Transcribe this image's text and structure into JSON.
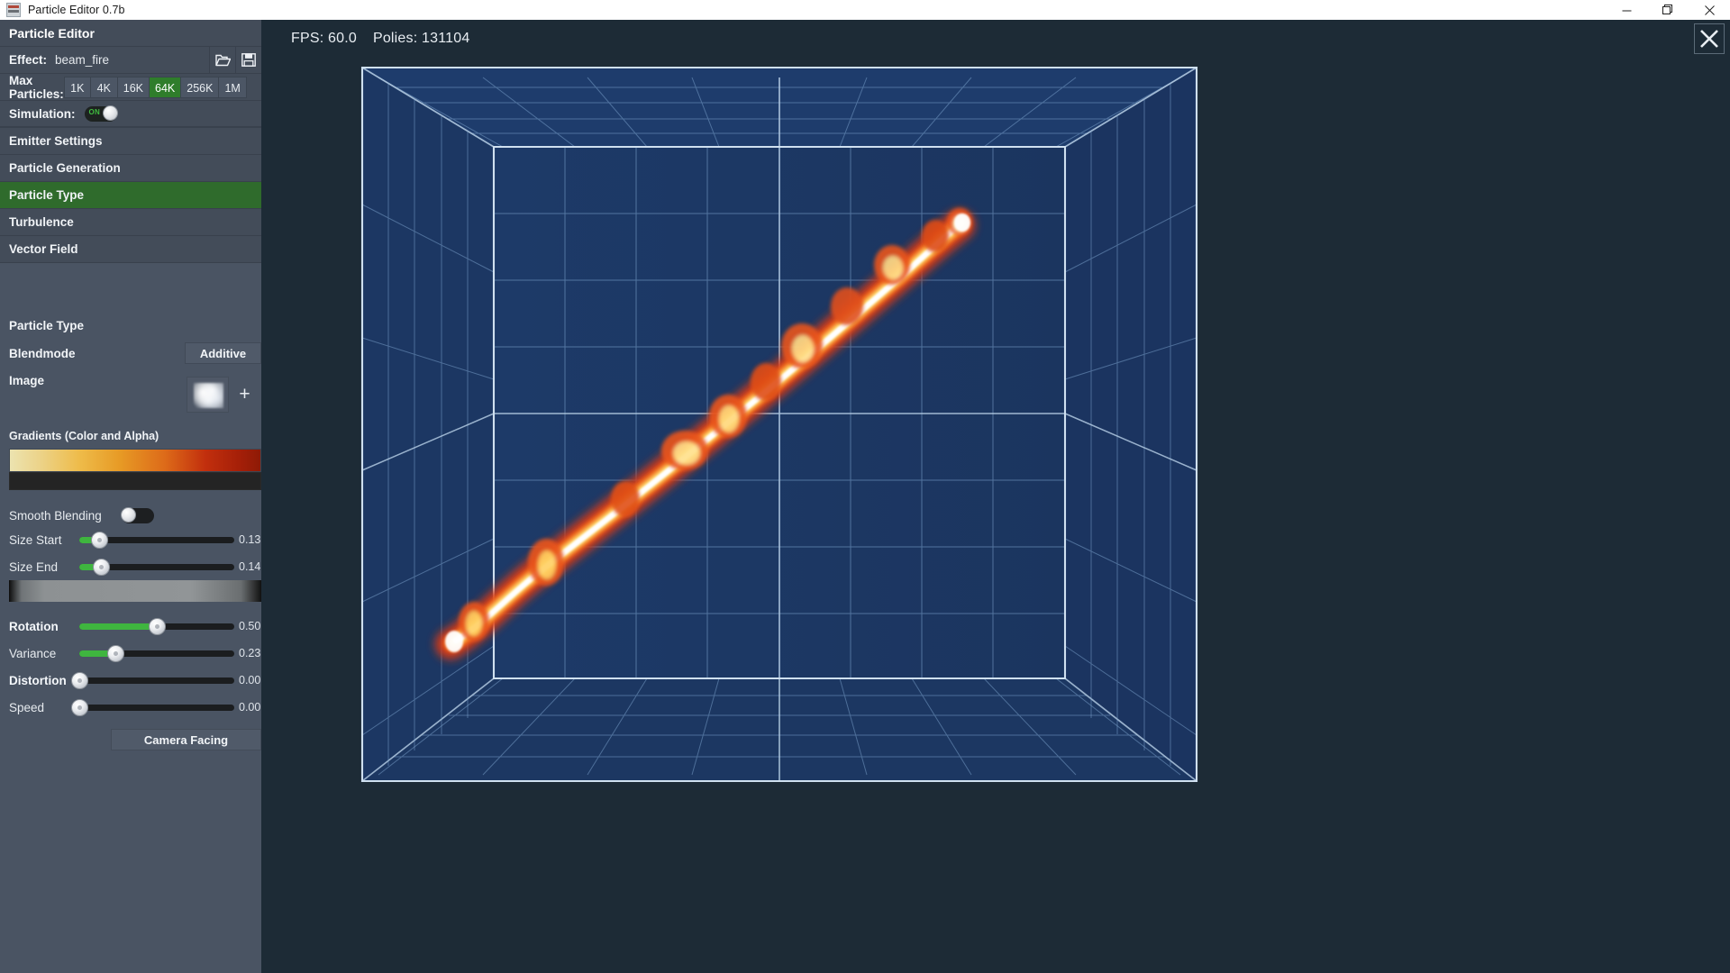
{
  "window": {
    "title": "Particle Editor 0.7b",
    "app_icon": "app-game-kit-icon",
    "controls": [
      {
        "name": "minimize-button",
        "glyph": "minimize-icon"
      },
      {
        "name": "maximize-button",
        "glyph": "maximize-icon"
      },
      {
        "name": "close-button",
        "glyph": "close-icon"
      }
    ]
  },
  "sidebar": {
    "panel_title": "Particle Editor",
    "effect": {
      "label": "Effect:",
      "value": "beam_fire",
      "open_icon": "folder-open-icon",
      "save_icon": "save-disk-icon"
    },
    "max_particles": {
      "label": "Max Particles:",
      "options": [
        "1K",
        "4K",
        "16K",
        "64K",
        "256K",
        "1M"
      ],
      "selected": "64K"
    },
    "simulation": {
      "label": "Simulation:",
      "state": "ON",
      "on": true
    },
    "nav": [
      {
        "label": "Emitter Settings",
        "active": false
      },
      {
        "label": "Particle Generation",
        "active": false
      },
      {
        "label": "Particle Type",
        "active": true
      },
      {
        "label": "Turbulence",
        "active": false
      },
      {
        "label": "Vector Field",
        "active": false
      }
    ],
    "section": {
      "heading": "Particle Type",
      "blendmode": {
        "label": "Blendmode",
        "value": "Additive"
      },
      "image": {
        "label": "Image",
        "thumb": "smoke-puff-thumbnail",
        "add": "+"
      },
      "gradients_heading": "Gradients (Color and Alpha)",
      "smooth_blending": {
        "label": "Smooth Blending",
        "on": false
      },
      "sliders": [
        {
          "label": "Size Start",
          "value": "0.13",
          "pct": 13,
          "bold": false
        },
        {
          "label": "Size End",
          "value": "0.14",
          "pct": 14,
          "bold": false
        },
        {
          "label": "Rotation",
          "value": "0.50",
          "pct": 50,
          "bold": true
        },
        {
          "label": "Variance",
          "value": "0.23",
          "pct": 23,
          "bold": false
        },
        {
          "label": "Distortion",
          "value": "0.00",
          "pct": 0,
          "bold": true
        },
        {
          "label": "Speed",
          "value": "0.00",
          "pct": 0,
          "bold": false
        }
      ],
      "camera_facing": "Camera Facing"
    }
  },
  "viewport": {
    "stats": {
      "fps_label": "FPS: 60.0",
      "polies_label": "Polies: 131104"
    },
    "close_overlay": "close-icon",
    "scene": {
      "description": "3d-wireframe-room-with-fire-beam",
      "background_color": "#1d2b36",
      "room_color": "#1e3a66",
      "grid_color": "#8fb3d9",
      "beam_core_color": "#ffffff",
      "beam_mid_color": "#ffe08a",
      "beam_edge_color": "#d93a12"
    }
  },
  "colors": {
    "accent_green": "#2f7d2b",
    "panel_bg": "#4a5463",
    "panel_header": "#434c59",
    "slider_green": "#3fb53f"
  }
}
